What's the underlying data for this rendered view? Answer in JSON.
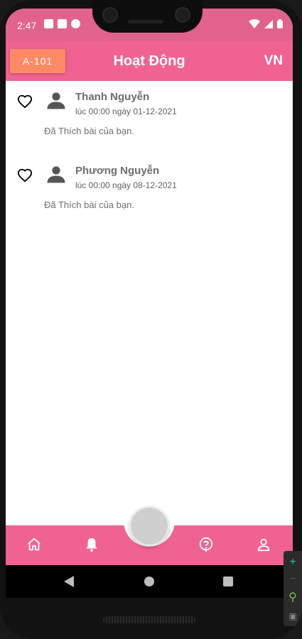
{
  "status": {
    "time": "2:47"
  },
  "appbar": {
    "room": "A-101",
    "title": "Hoạt Động",
    "language": "VN"
  },
  "activities": [
    {
      "name": "Thanh Nguyễn",
      "time": "lúc 00:00 ngày 01-12-2021",
      "message": "Đã Thích bài của bạn."
    },
    {
      "name": "Phương Nguyễn",
      "time": "lúc 00:00 ngày 08-12-2021",
      "message": "Đã Thích bài của bạn."
    }
  ],
  "nav": {
    "items": [
      "home-icon",
      "bell-icon",
      "help-icon",
      "user-icon"
    ]
  },
  "colors": {
    "primary": "#f06292",
    "status": "#e0628d",
    "room_button": "#ff8a65"
  }
}
